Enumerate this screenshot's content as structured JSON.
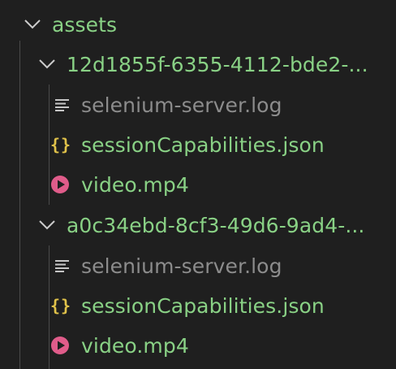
{
  "explorer": {
    "root": {
      "label": "assets",
      "icon": "chevron-down-icon"
    },
    "folders": [
      {
        "label": "12d1855f-6355-4112-bde2-...",
        "icon": "chevron-down-icon",
        "files": [
          {
            "label": "selenium-server.log",
            "icon": "log-file-icon"
          },
          {
            "label": "sessionCapabilities.json",
            "icon": "json-file-icon"
          },
          {
            "label": "video.mp4",
            "icon": "video-file-icon"
          }
        ]
      },
      {
        "label": "a0c34ebd-8cf3-49d6-9ad4-...",
        "icon": "chevron-down-icon",
        "files": [
          {
            "label": "selenium-server.log",
            "icon": "log-file-icon"
          },
          {
            "label": "sessionCapabilities.json",
            "icon": "json-file-icon"
          },
          {
            "label": "video.mp4",
            "icon": "video-file-icon"
          }
        ]
      }
    ],
    "colors": {
      "background": "#1f1f1f",
      "untracked_green": "#89d185",
      "ignored_gray": "#8c8c8c",
      "json_icon": "#e0c24a",
      "video_icon": "#e05c8a"
    }
  }
}
